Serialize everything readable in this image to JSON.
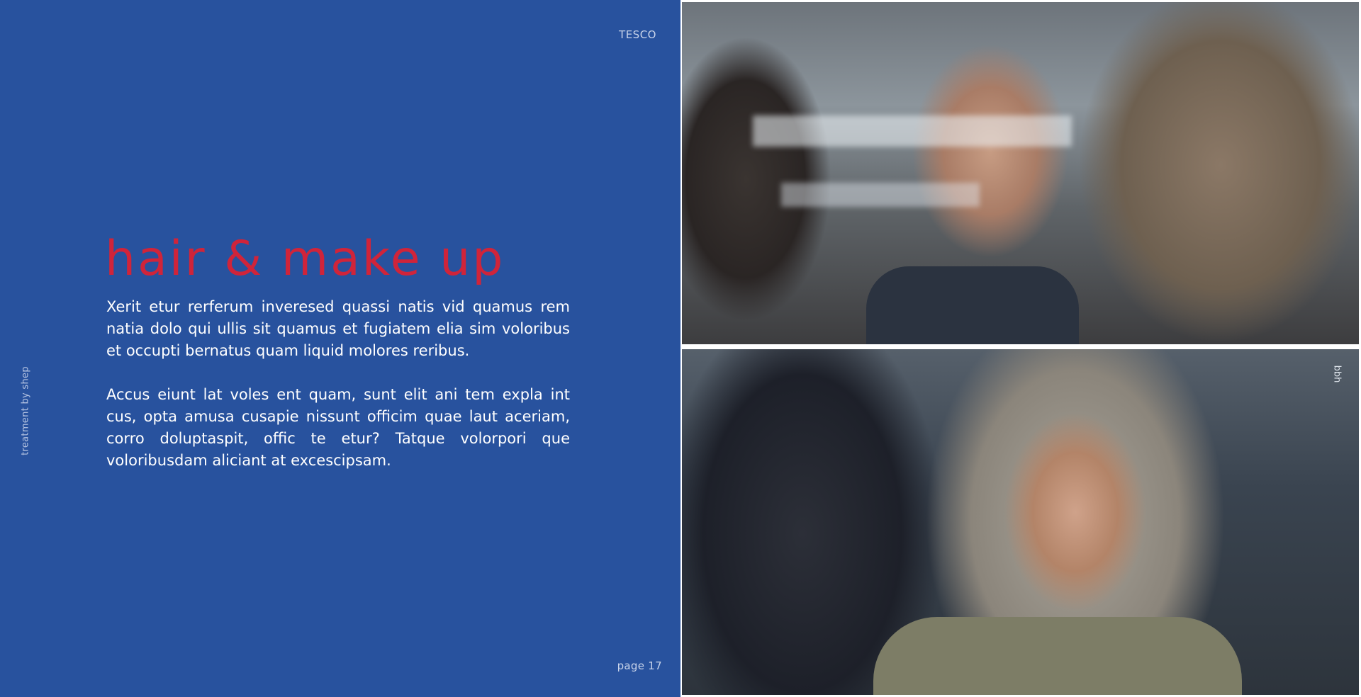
{
  "header": {
    "brand": "TESCO"
  },
  "sidebar": {
    "vertical_label": "treatment by shep"
  },
  "main": {
    "title": "hair & make up",
    "paragraphs": [
      "Xerit etur rerferum inveresed quassi natis vid quamus rem natia dolo qui ullis sit quamus et fugiatem elia sim voloribus et occupti bernatus quam liquid molores reribus.",
      "Accus eiunt lat voles ent quam, sunt elit ani tem expla int cus, opta amusa cusapie nissunt officim quae laut aceriam, corro doluptaspit, offic te etur? Tatque volorpori que voloribusdam aliciant at excescipsam."
    ]
  },
  "footer": {
    "page_number": "page 17"
  },
  "images": {
    "agency_label": "bbh",
    "top_photo": "man-with-mustache-photo",
    "bottom_photo": "woman-with-grey-hair-photo"
  },
  "colors": {
    "panel_bg": "#28529e",
    "title": "#d0243a",
    "body_text": "#ffffff"
  }
}
